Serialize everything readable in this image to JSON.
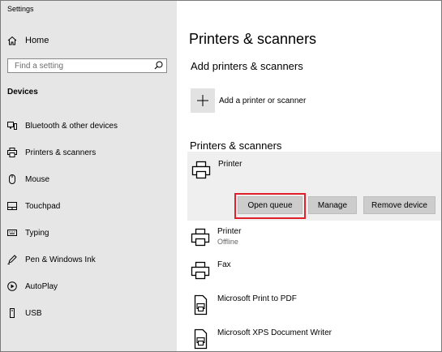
{
  "window": {
    "title": "Settings"
  },
  "sidebar": {
    "home_label": "Home",
    "search_placeholder": "Find a setting",
    "section_label": "Devices",
    "items": [
      {
        "label": "Bluetooth & other devices",
        "icon": "bluetooth-devices-icon"
      },
      {
        "label": "Printers & scanners",
        "icon": "printer-icon"
      },
      {
        "label": "Mouse",
        "icon": "mouse-icon"
      },
      {
        "label": "Touchpad",
        "icon": "touchpad-icon"
      },
      {
        "label": "Typing",
        "icon": "keyboard-icon"
      },
      {
        "label": "Pen & Windows Ink",
        "icon": "pen-icon"
      },
      {
        "label": "AutoPlay",
        "icon": "autoplay-icon"
      },
      {
        "label": "USB",
        "icon": "usb-icon"
      }
    ]
  },
  "main": {
    "title": "Printers & scanners",
    "add_section_title": "Add printers & scanners",
    "add_label": "Add a printer or scanner",
    "list_title": "Printers & scanners",
    "selected_printer": {
      "name": "Printer",
      "buttons": {
        "open_queue": "Open queue",
        "manage": "Manage",
        "remove": "Remove device"
      }
    },
    "printers": [
      {
        "name": "Printer",
        "status": "Offline",
        "icon": "printer-icon"
      },
      {
        "name": "Fax",
        "status": "",
        "icon": "printer-icon"
      },
      {
        "name": "Microsoft Print to PDF",
        "status": "",
        "icon": "document-printer-icon"
      },
      {
        "name": "Microsoft XPS Document Writer",
        "status": "",
        "icon": "document-printer-icon"
      }
    ]
  },
  "colors": {
    "sidebar_bg": "#e6e6e6",
    "selected_bg": "#efefef",
    "button_bg": "#cccccc",
    "highlight": "#e0202a"
  }
}
